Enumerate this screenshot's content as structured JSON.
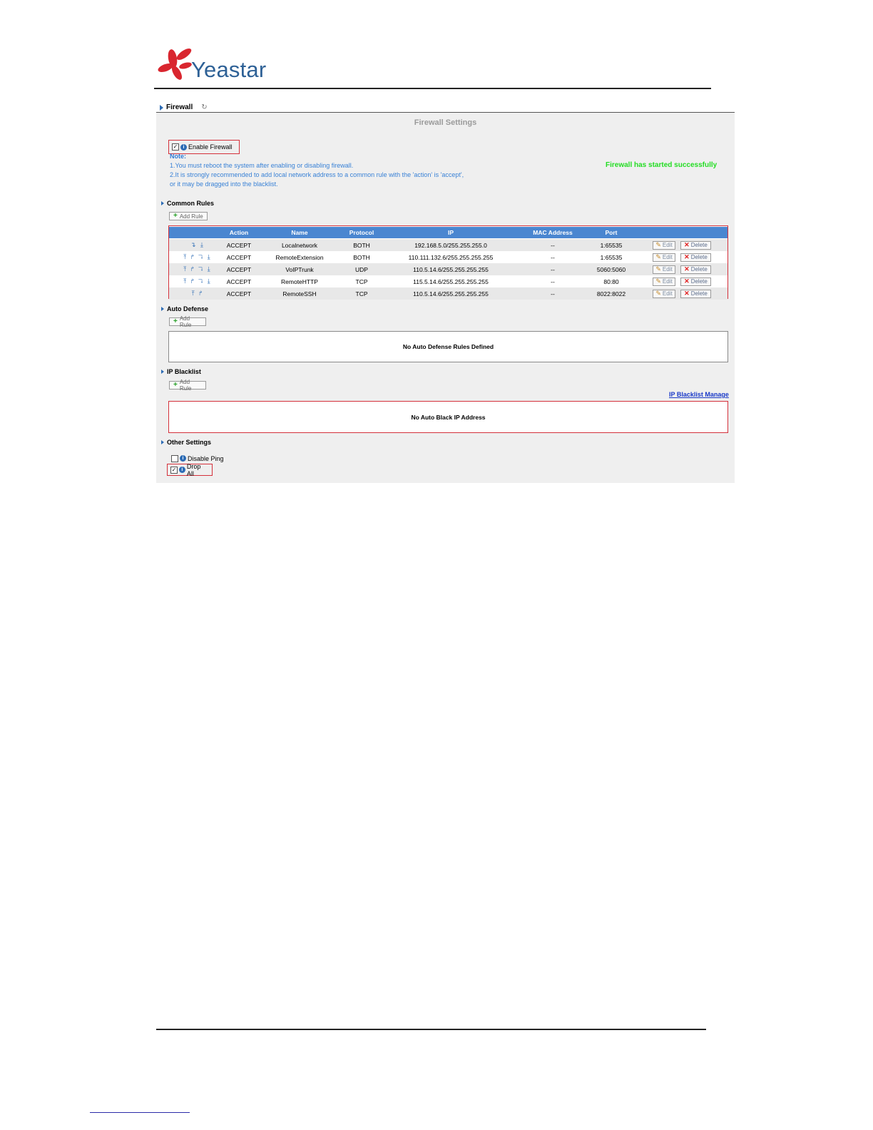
{
  "logo": {
    "text": "Yeastar"
  },
  "breadcrumb": {
    "title": "Firewall",
    "refresh_glyph": "↻"
  },
  "panel": {
    "title": "Firewall Settings"
  },
  "enable_firewall": {
    "label": "Enable Firewall",
    "checked": true
  },
  "note": {
    "title": "Note:",
    "lines": [
      "1.You must reboot the system after enabling or disabling firewall.",
      "2.It is strongly recommended to add local network address to a common rule with the 'action' is 'accept',",
      "or it may be dragged into the blacklist."
    ]
  },
  "status": {
    "text": "Firewall has started successfully",
    "color": "#22dd22"
  },
  "common_rules": {
    "title": "Common Rules",
    "add_label": "Add Rule",
    "columns": [
      "Action",
      "Name",
      "Protocol",
      "IP",
      "MAC Address",
      "Port"
    ],
    "edit_label": "Edit",
    "delete_label": "Delete",
    "rows": [
      {
        "arrows": "↴ ⤓",
        "action": "ACCEPT",
        "name": "Localnetwork",
        "protocol": "BOTH",
        "ip": "192.168.5.0/255.255.255.0",
        "mac": "--",
        "port": "1:65535"
      },
      {
        "arrows": "⤒ ↱ ↴ ⤓",
        "action": "ACCEPT",
        "name": "RemoteExtension",
        "protocol": "BOTH",
        "ip": "110.111.132.6/255.255.255.255",
        "mac": "--",
        "port": "1:65535"
      },
      {
        "arrows": "⤒ ↱ ↴ ⤓",
        "action": "ACCEPT",
        "name": "VoIPTrunk",
        "protocol": "UDP",
        "ip": "110.5.14.6/255.255.255.255",
        "mac": "--",
        "port": "5060:5060"
      },
      {
        "arrows": "⤒ ↱ ↴ ⤓",
        "action": "ACCEPT",
        "name": "RemoteHTTP",
        "protocol": "TCP",
        "ip": "115.5.14.6/255.255.255.255",
        "mac": "--",
        "port": "80:80"
      },
      {
        "arrows": "⤒ ↱",
        "action": "ACCEPT",
        "name": "RemoteSSH",
        "protocol": "TCP",
        "ip": "110.5.14.6/255.255.255.255",
        "mac": "--",
        "port": "8022:8022"
      }
    ]
  },
  "auto_defense": {
    "title": "Auto Defense",
    "add_label": "Add Rule",
    "empty_text": "No Auto Defense Rules Defined"
  },
  "ip_blacklist": {
    "title": "IP Blacklist",
    "add_label": "Add Rule",
    "manage_link": "IP Blacklist Manage",
    "empty_text": "No Auto Black IP Address"
  },
  "other_settings": {
    "title": "Other Settings",
    "disable_ping": {
      "label": "Disable Ping",
      "checked": false
    },
    "drop_all": {
      "label": "Drop All",
      "checked": true
    }
  },
  "colors": {
    "accent": "#2d6cb5",
    "header_blue": "#4a86d0",
    "highlight_red": "#d4303a",
    "note_blue": "#3a82d6"
  }
}
